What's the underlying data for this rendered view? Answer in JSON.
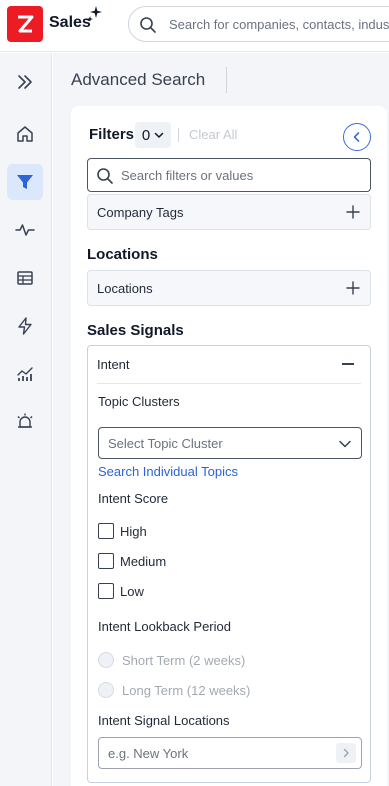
{
  "header": {
    "logo_letter": "Z",
    "brand": "Sales",
    "search_placeholder": "Search for companies, contacts, industries"
  },
  "sidebar": {
    "items": [
      {
        "icon": "double-chevron-right-icon",
        "active": false
      },
      {
        "icon": "home-icon",
        "active": false
      },
      {
        "icon": "filter-icon",
        "active": true
      },
      {
        "icon": "pulse-icon",
        "active": false
      },
      {
        "icon": "table-icon",
        "active": false
      },
      {
        "icon": "bolt-icon",
        "active": false
      },
      {
        "icon": "analytics-icon",
        "active": false
      },
      {
        "icon": "alarm-icon",
        "active": false
      }
    ]
  },
  "main": {
    "title": "Advanced Search",
    "filters": {
      "label": "Filters",
      "count": "0",
      "clear_all": "Clear All",
      "search_placeholder": "Search filters or values"
    },
    "company_tags": "Company Tags",
    "locations_section": "Locations",
    "locations_row": "Locations",
    "sales_signals_section": "Sales Signals",
    "intent": {
      "label": "Intent",
      "topic_clusters_label": "Topic Clusters",
      "topic_cluster_placeholder": "Select Topic Cluster",
      "search_topics_link": "Search Individual Topics",
      "intent_score_label": "Intent Score",
      "scores": [
        "High",
        "Medium",
        "Low"
      ],
      "lookback_label": "Intent Lookback Period",
      "lookback_options": [
        "Short Term (2 weeks)",
        "Long Term (12 weeks)"
      ],
      "signal_locations_label": "Intent Signal Locations",
      "signal_locations_placeholder": "e.g. New York"
    }
  },
  "colors": {
    "brand_red": "#ed1b24",
    "accent_blue": "#2b63d9",
    "active_nav_bg": "#dbe7fb",
    "panel_bg": "#f3f5f8"
  }
}
